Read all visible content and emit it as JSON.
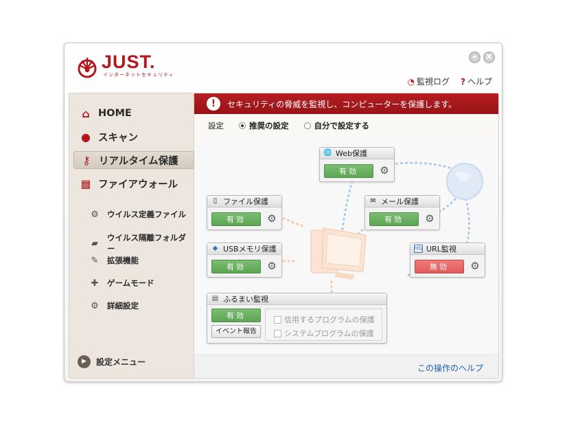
{
  "app": {
    "logo_text": "JUST.",
    "logo_sub": "インターネットセキュリティ",
    "brand_color": "#b3161d"
  },
  "window_controls": {
    "minimize": "–",
    "close": "×"
  },
  "top_links": {
    "log": "監視ログ",
    "help": "ヘルプ",
    "help_prefix": "?"
  },
  "sidebar": {
    "main_items": [
      {
        "label": "HOME",
        "icon": "home-icon"
      },
      {
        "label": "スキャン",
        "icon": "magnifier-icon"
      },
      {
        "label": "リアルタイム保護",
        "icon": "key-icon",
        "active": true
      },
      {
        "label": "ファイアウォール",
        "icon": "brick-wall-icon"
      }
    ],
    "sub_items": [
      {
        "label": "ウイルス定義ファイル",
        "icon": "gears-icon"
      },
      {
        "label": "ウイルス隔離フォルダー",
        "icon": "folder-icon"
      },
      {
        "label": "拡張機能",
        "icon": "wrench-icon"
      },
      {
        "label": "ゲームモード",
        "icon": "gamepad-icon"
      },
      {
        "label": "詳細設定",
        "icon": "gear-icon"
      }
    ],
    "bottom": {
      "label": "設定メニュー",
      "icon": "play-circle-icon"
    }
  },
  "banner": {
    "text": "セキュリティの脅威を監視し、コンピューターを保護します。",
    "icon": "!"
  },
  "settings": {
    "label": "設定",
    "option_recommended": "推奨の設定",
    "option_custom": "自分で設定する",
    "selected": "recommended"
  },
  "cards": {
    "web": {
      "title": "Web保護",
      "state": "有効"
    },
    "mail": {
      "title": "メール保護",
      "state": "有効"
    },
    "file": {
      "title": "ファイル保護",
      "state": "有効"
    },
    "usb": {
      "title": "USBメモリ保護",
      "state": "有効"
    },
    "url": {
      "title": "URL監視",
      "state": "無効",
      "icon_text": "http"
    },
    "behavior": {
      "title": "ふるまい監視",
      "state": "有効",
      "event_button": "イベント報告",
      "options": [
        "信用するプログラムの保護",
        "システムプログラムの保護"
      ]
    }
  },
  "footer": {
    "help_link": "この操作のヘルプ"
  }
}
